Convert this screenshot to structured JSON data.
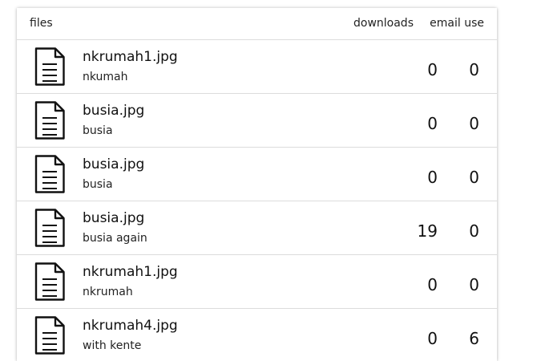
{
  "header": {
    "files": "files",
    "downloads": "downloads",
    "email_use": "email use"
  },
  "icons": {
    "file": "document-icon"
  },
  "rows": [
    {
      "name": "nkrumah1.jpg",
      "description": "nkumah",
      "downloads": "0",
      "email_use": "0"
    },
    {
      "name": "busia.jpg",
      "description": "busia",
      "downloads": "0",
      "email_use": "0"
    },
    {
      "name": "busia.jpg",
      "description": "busia",
      "downloads": "0",
      "email_use": "0"
    },
    {
      "name": "busia.jpg",
      "description": "busia again",
      "downloads": "19",
      "email_use": "0"
    },
    {
      "name": "nkrumah1.jpg",
      "description": "nkrumah",
      "downloads": "0",
      "email_use": "0"
    },
    {
      "name": "nkrumah4.jpg",
      "description": "with kente",
      "downloads": "0",
      "email_use": "6"
    }
  ]
}
